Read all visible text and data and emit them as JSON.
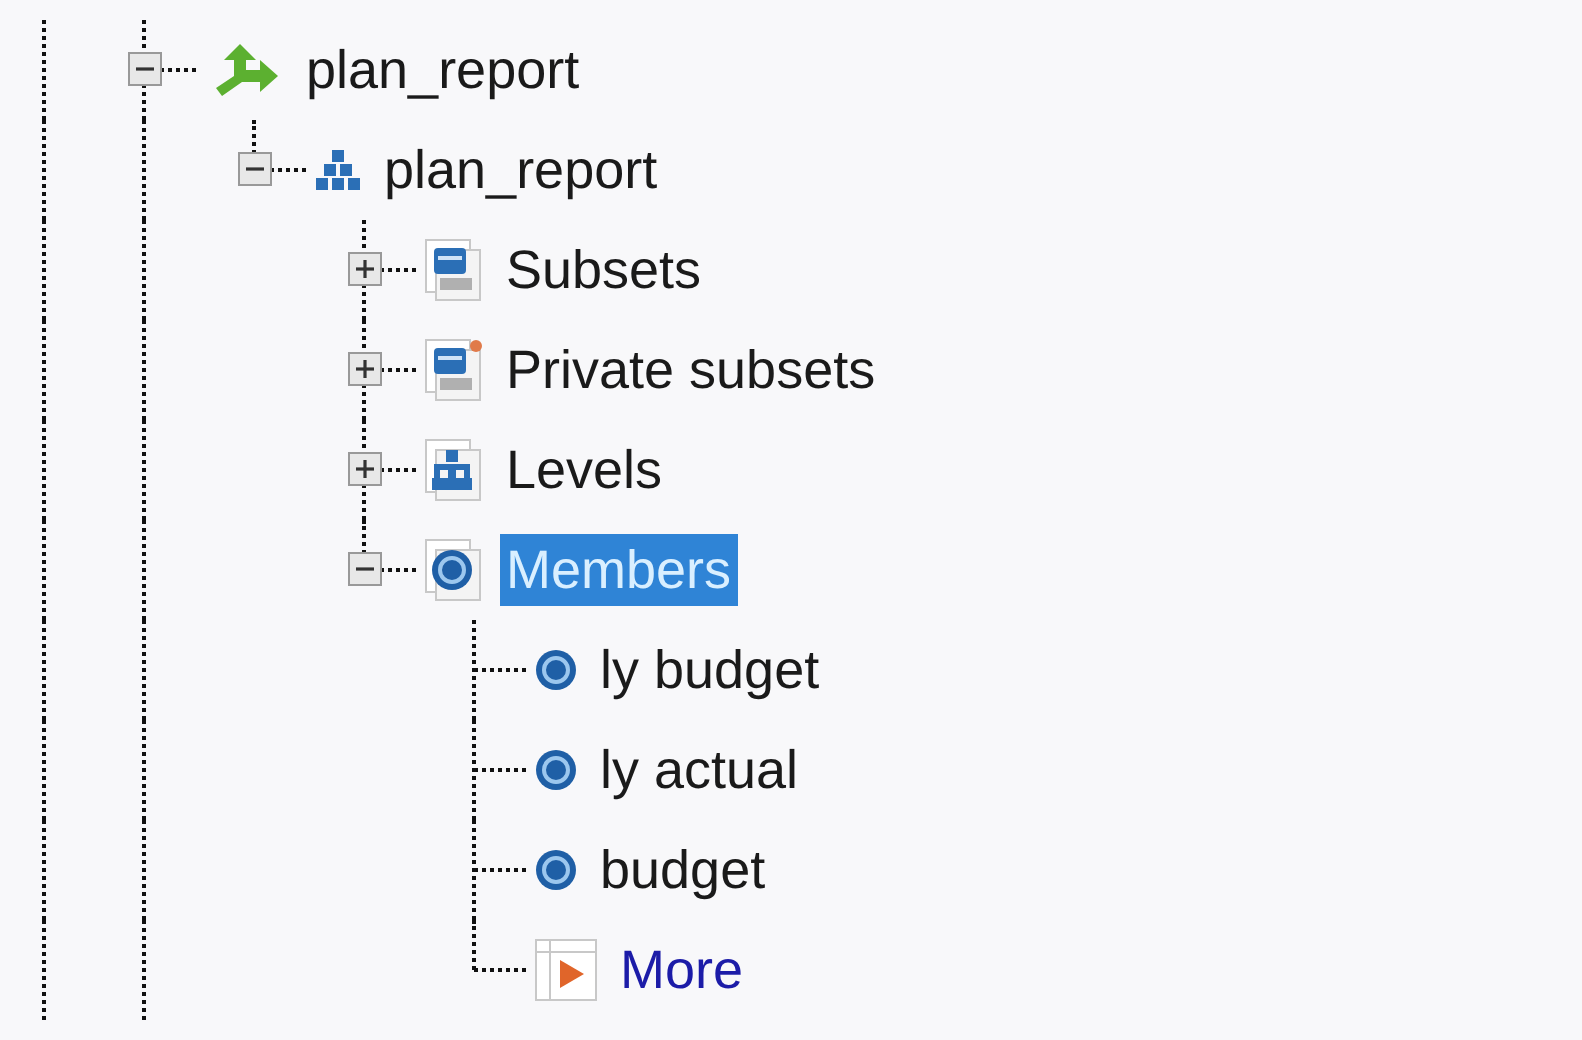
{
  "tree": [
    {
      "label": "plan_report",
      "kind": "cube",
      "expanded": true,
      "selected": false,
      "children": [
        {
          "label": "plan_report",
          "kind": "dimension",
          "expanded": true,
          "selected": false,
          "children": [
            {
              "label": "Subsets",
              "kind": "subsets",
              "expanded": false,
              "selected": false
            },
            {
              "label": "Private subsets",
              "kind": "private_subsets",
              "expanded": false,
              "selected": false
            },
            {
              "label": "Levels",
              "kind": "levels",
              "expanded": false,
              "selected": false
            },
            {
              "label": "Members",
              "kind": "members",
              "expanded": true,
              "selected": true,
              "children": [
                {
                  "label": "ly budget",
                  "kind": "element",
                  "selected": false
                },
                {
                  "label": "ly actual",
                  "kind": "element",
                  "selected": false
                },
                {
                  "label": "budget",
                  "kind": "element",
                  "selected": false
                },
                {
                  "label": "More",
                  "kind": "more",
                  "selected": false
                }
              ]
            }
          ]
        }
      ]
    }
  ]
}
